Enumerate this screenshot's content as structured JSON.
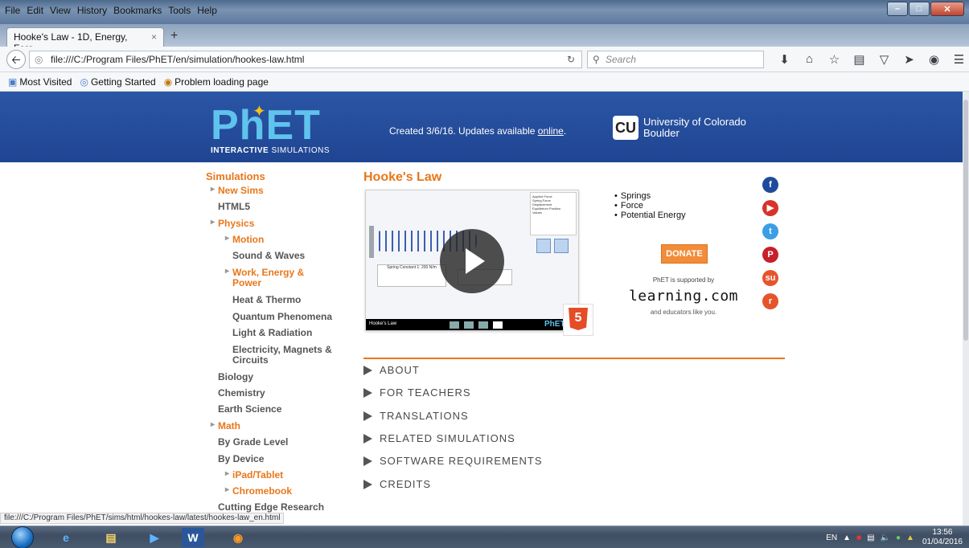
{
  "browser": {
    "menu": [
      "File",
      "Edit",
      "View",
      "History",
      "Bookmarks",
      "Tools",
      "Help"
    ],
    "tab_title": "Hooke's Law - 1D, Energy, Forc...",
    "tab_close": "×",
    "new_tab": "+",
    "url": "file:///C:/Program Files/PhET/en/simulation/hookes-law.html",
    "search_placeholder": "Search",
    "bookmarks": [
      "Most Visited",
      "Getting Started",
      "Problem loading page"
    ],
    "status_url": "file:///C:/Program Files/PhET/sims/html/hookes-law/latest/hookes-law_en.html"
  },
  "banner": {
    "logo_word": "PhET",
    "logo_sub_bold": "INTERACTIVE",
    "logo_sub_rest": "SIMULATIONS",
    "created_text": "Created 3/6/16. Updates available ",
    "created_link": "online",
    "created_end": ".",
    "cu_mark": "CU",
    "cu_line1": "University of Colorado",
    "cu_line2": "Boulder"
  },
  "sidebar": {
    "heading": "Simulations",
    "items": [
      {
        "label": "New Sims"
      },
      {
        "label": "HTML5"
      },
      {
        "label": "Physics"
      },
      {
        "label": "Motion"
      },
      {
        "label": "Sound & Waves"
      },
      {
        "label": "Work, Energy &"
      },
      {
        "label": "Power"
      },
      {
        "label": "Heat & Thermo"
      },
      {
        "label": "Quantum Phenomena"
      },
      {
        "label": "Light & Radiation"
      },
      {
        "label": "Electricity, Magnets &"
      },
      {
        "label": "Circuits"
      },
      {
        "label": "Biology"
      },
      {
        "label": "Chemistry"
      },
      {
        "label": "Earth Science"
      },
      {
        "label": "Math"
      },
      {
        "label": "By Grade Level"
      },
      {
        "label": "By Device"
      },
      {
        "label": "iPad/Tablet"
      },
      {
        "label": "Chromebook"
      },
      {
        "label": "Cutting Edge Research"
      }
    ]
  },
  "main": {
    "title": "Hooke's Law",
    "sim_bar_label": "Hooke's Law",
    "sim_bar_logo": "PhET",
    "html5_badge": "5",
    "controls": {
      "checkboxes": [
        "Applied Force",
        "Spring Force",
        "Displacement",
        "Equilibrium Position",
        "Values"
      ],
      "spring_constant": "Spring Constant 1:  200 N/m"
    },
    "topics": [
      "Springs",
      "Force",
      "Potential Energy"
    ],
    "donate": "DONATE",
    "supported": "PhET is supported by",
    "learning": "learning.com",
    "educators": "and educators like you.",
    "social": [
      {
        "name": "facebook-icon",
        "glyph": "f",
        "color": "#1f4a9c"
      },
      {
        "name": "youtube-icon",
        "glyph": "▶",
        "color": "#d6332a"
      },
      {
        "name": "twitter-icon",
        "glyph": "t",
        "color": "#3b9ee6"
      },
      {
        "name": "pinterest-icon",
        "glyph": "P",
        "color": "#c6202c"
      },
      {
        "name": "stumbleupon-icon",
        "glyph": "su",
        "color": "#e5552b"
      },
      {
        "name": "reddit-icon",
        "glyph": "r",
        "color": "#e5552b"
      }
    ],
    "accordion": [
      "ABOUT",
      "FOR TEACHERS",
      "TRANSLATIONS",
      "RELATED SIMULATIONS",
      "SOFTWARE REQUIREMENTS",
      "CREDITS"
    ]
  },
  "taskbar": {
    "lang": "EN",
    "time": "13:56",
    "date": "01/04/2016"
  },
  "colors": {
    "banner": "#2b56a5",
    "accent": "#e8771a",
    "phet_blue": "#5fc3ee"
  }
}
